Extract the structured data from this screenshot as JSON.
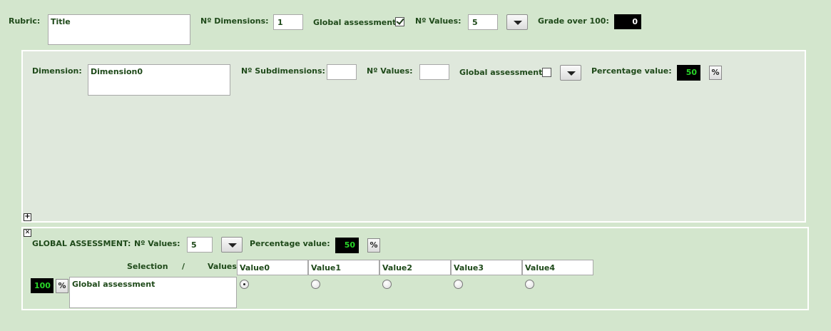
{
  "rubric": {
    "label": "Rubric:",
    "title_value": "Title",
    "dimensions_label": "Nº Dimensions:",
    "dimensions_value": "1",
    "global_assessment_label": "Global assessment",
    "global_assessment_checked": true,
    "values_label": "Nº Values:",
    "values_value": "5",
    "grade_label": "Grade over 100:",
    "grade_value": "0"
  },
  "dimension": {
    "close_glyph": "✕",
    "label": "Dimension:",
    "name_value": "Dimension0",
    "subdimensions_label": "Nº Subdimensions:",
    "subdimensions_value": "",
    "values_label": "Nº Values:",
    "values_value": "",
    "global_assessment_label": "Global assessment",
    "global_assessment_checked": false,
    "percentage_label": "Percentage value:",
    "percentage_value": "50",
    "pct_glyph": "%",
    "add_glyph": "+"
  },
  "global": {
    "close_glyph": "✕",
    "heading": "GLOBAL ASSESSMENT:",
    "values_label": "Nº Values:",
    "values_value": "5",
    "percentage_label": "Percentage value:",
    "percentage_value": "50",
    "pct_glyph": "%",
    "selection_label": "Selection",
    "slash": "/",
    "values_header": "Values",
    "value_headers": [
      "Value0",
      "Value1",
      "Value2",
      "Value3",
      "Value4"
    ],
    "selected_index": 0,
    "row_percentage": "100",
    "row_text": "Global assessment"
  },
  "colors": {
    "background": "#d3e6cd",
    "label_text": "#1f4a1a",
    "display_bg": "#000000",
    "display_green": "#29d629"
  }
}
